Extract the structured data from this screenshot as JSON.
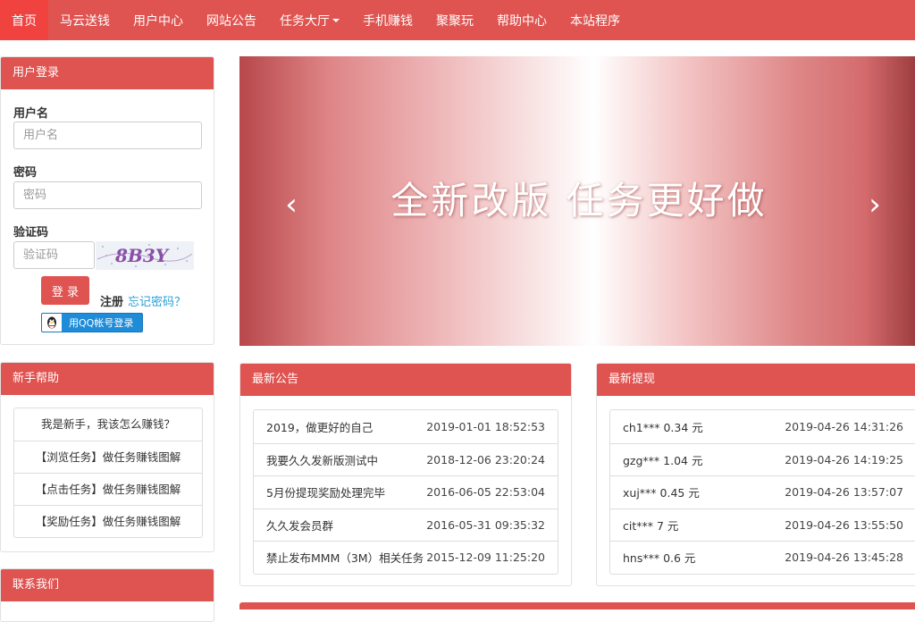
{
  "nav": {
    "items": [
      "首页",
      "马云送钱",
      "用户中心",
      "网站公告",
      "任务大厅",
      "手机赚钱",
      "聚聚玩",
      "帮助中心",
      "本站程序"
    ]
  },
  "login": {
    "title": "用户登录",
    "username_label": "用户名",
    "username_placeholder": "用户名",
    "password_label": "密码",
    "password_placeholder": "密码",
    "captcha_label": "验证码",
    "captcha_placeholder": "验证码",
    "captcha_text": "8B3Y",
    "submit_label": "登 录",
    "register_label": "注册",
    "forgot_label": "忘记密码？",
    "qq_login_label": "用QQ帐号登录"
  },
  "help": {
    "title": "新手帮助",
    "items": [
      "我是新手，我该怎么赚钱？",
      "【浏览任务】做任务赚钱图解",
      "【点击任务】做任务赚钱图解",
      "【奖励任务】做任务赚钱图解"
    ]
  },
  "contact": {
    "title": "联系我们"
  },
  "banner": {
    "text": "全新改版  任务更好做"
  },
  "notices": {
    "title": "最新公告",
    "rows": [
      {
        "text": "2019，做更好的自己",
        "date": "2019-01-01 18:52:53"
      },
      {
        "text": "我要久久发新版测试中",
        "date": "2018-12-06 23:20:24"
      },
      {
        "text": "5月份提现奖励处理完毕",
        "date": "2016-06-05 22:53:04"
      },
      {
        "text": "久久发会员群",
        "date": "2016-05-31 09:35:32"
      },
      {
        "text": "禁止发布MMM（3M）相关任务",
        "date": "2015-12-09 11:25:20"
      }
    ]
  },
  "withdraws": {
    "title": "最新提现",
    "rows": [
      {
        "text": "ch1*** 0.34 元",
        "date": "2019-04-26 14:31:26"
      },
      {
        "text": "gzg*** 1.04 元",
        "date": "2019-04-26 14:19:25"
      },
      {
        "text": "xuj*** 0.45 元",
        "date": "2019-04-26 13:57:07"
      },
      {
        "text": "cit*** 7 元",
        "date": "2019-04-26 13:55:50"
      },
      {
        "text": "hns*** 0.6 元",
        "date": "2019-04-26 13:45:28"
      }
    ]
  },
  "colors": {
    "primary": "#df5350",
    "active": "#f0423f",
    "link": "#2a9fd6",
    "qq": "#1e8cd8"
  }
}
